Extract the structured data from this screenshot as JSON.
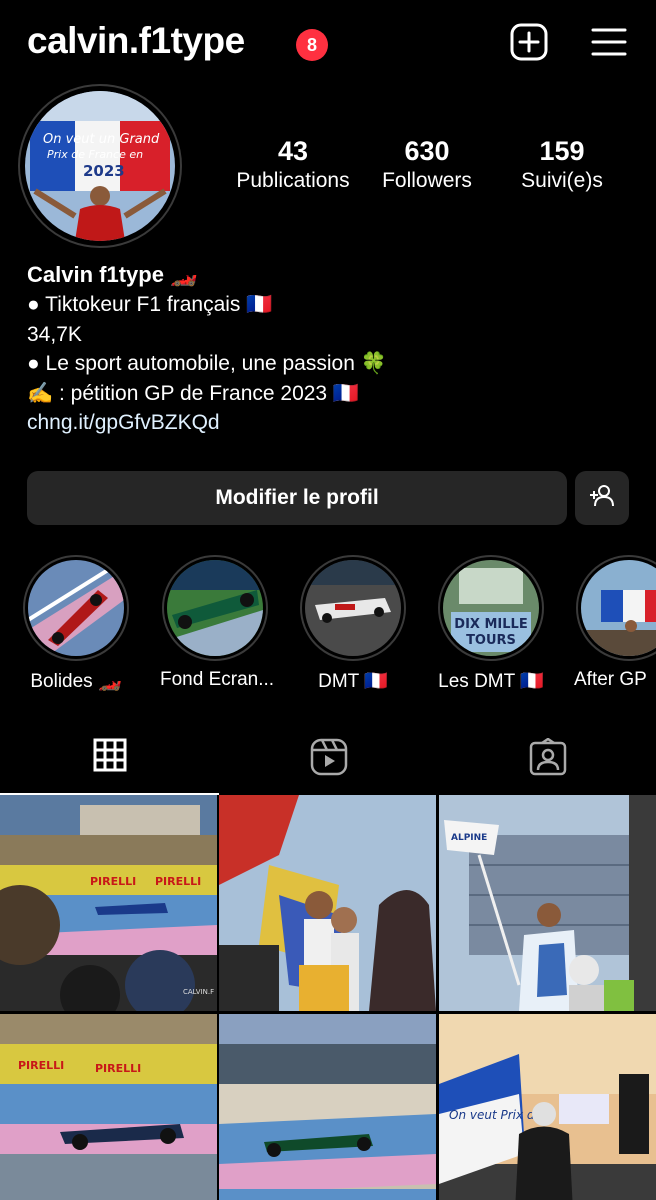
{
  "header": {
    "username": "calvin.f1type",
    "notification_count": "8",
    "create_icon": "plus-square-icon",
    "menu_icon": "hamburger-menu-icon"
  },
  "stats": [
    {
      "count": "43",
      "label": "Publications"
    },
    {
      "count": "630",
      "label": "Followers"
    },
    {
      "count": "159",
      "label": "Suivi(e)s"
    }
  ],
  "bio": {
    "name": "Calvin f1type 🏎️",
    "lines": [
      "● Tiktokeur F1 français 🇫🇷",
      "34,7K",
      "● Le sport automobile, une passion 🍀",
      "✍️ : pétition GP de France 2023 🇫🇷"
    ],
    "link": "chng.it/gpGfvBZKQd"
  },
  "profile_avatar_text": {
    "line1": "On veut un Grand",
    "line2": "Prix de France en",
    "line3": "2023"
  },
  "buttons": {
    "edit_profile": "Modifier le profil",
    "add_person_icon": "add-person-icon"
  },
  "highlights": [
    {
      "label": "Bolides 🏎️"
    },
    {
      "label": "Fond Ecran..."
    },
    {
      "label": "DMT 🇫🇷"
    },
    {
      "label": "Les DMT 🇫🇷"
    },
    {
      "label": "After GP"
    }
  ],
  "highlight_texts": {
    "dix_mille": "DIX MILLE",
    "tours": "TOURS"
  },
  "tabs": [
    {
      "icon": "grid-icon",
      "active": true
    },
    {
      "icon": "reels-icon",
      "active": false
    },
    {
      "icon": "tagged-icon",
      "active": false
    }
  ],
  "post_texts": {
    "pirelli": "PIRELLI",
    "alpine": "ALPINE",
    "watermark": "CALVIN.F",
    "flag_text": "On veut Prix de"
  },
  "colors": {
    "background": "#000000",
    "badge": "#ff3040",
    "button_bg": "#262626",
    "link": "#e0f1ff"
  }
}
